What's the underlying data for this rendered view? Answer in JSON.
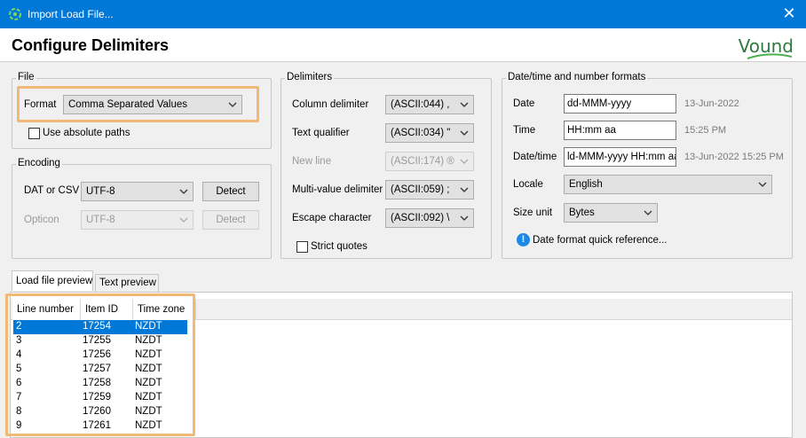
{
  "window": {
    "title": "Import Load File...",
    "close_icon": "close-icon",
    "app_icon": "import-icon"
  },
  "header": {
    "heading": "Configure Delimiters",
    "logo_text": "Vound",
    "logo_color": "#2d7a3f"
  },
  "file_group": {
    "legend": "File",
    "format_label": "Format",
    "format_value": "Comma Separated Values",
    "absolute_paths_label": "Use absolute paths",
    "absolute_paths_checked": false
  },
  "encoding_group": {
    "legend": "Encoding",
    "dat_label": "DAT or CSV",
    "dat_value": "UTF-8",
    "dat_detect": "Detect",
    "opticon_label": "Opticon",
    "opticon_value": "UTF-8",
    "opticon_detect": "Detect"
  },
  "delimiters_group": {
    "legend": "Delimiters",
    "column_label": "Column delimiter",
    "column_value": "(ASCII:044) ,",
    "text_qualifier_label": "Text qualifier",
    "text_qualifier_value": "(ASCII:034) \"",
    "new_line_label": "New line",
    "new_line_value": "(ASCII:174) ®",
    "multi_value_label": "Multi-value delimiter",
    "multi_value_value": "(ASCII:059) ;",
    "escape_label": "Escape character",
    "escape_value": "(ASCII:092) \\",
    "strict_quotes_label": "Strict quotes",
    "strict_quotes_checked": false
  },
  "formats_group": {
    "legend": "Date/time and number formats",
    "date_label": "Date",
    "date_value": "dd-MMM-yyyy",
    "date_example": "13-Jun-2022",
    "time_label": "Time",
    "time_value": "HH:mm aa",
    "time_example": "15:25 PM",
    "datetime_label": "Date/time",
    "datetime_value": "ld-MMM-yyyy HH:mm aa",
    "datetime_example": "13-Jun-2022 15:25 PM",
    "locale_label": "Locale",
    "locale_value": "English",
    "size_unit_label": "Size unit",
    "size_unit_value": "Bytes",
    "quick_reference_link": "Date format quick reference...",
    "info_icon": "info-icon"
  },
  "tabs": [
    {
      "label": "Load file preview",
      "active": true
    },
    {
      "label": "Text preview",
      "active": false
    }
  ],
  "preview_table": {
    "columns": [
      "Line number",
      "Item ID",
      "Time zone"
    ],
    "rows": [
      {
        "line": "2",
        "item_id": "17254",
        "tz": "NZDT",
        "selected": true
      },
      {
        "line": "3",
        "item_id": "17255",
        "tz": "NZDT"
      },
      {
        "line": "4",
        "item_id": "17256",
        "tz": "NZDT"
      },
      {
        "line": "5",
        "item_id": "17257",
        "tz": "NZDT"
      },
      {
        "line": "6",
        "item_id": "17258",
        "tz": "NZDT"
      },
      {
        "line": "7",
        "item_id": "17259",
        "tz": "NZDT"
      },
      {
        "line": "8",
        "item_id": "17260",
        "tz": "NZDT"
      },
      {
        "line": "9",
        "item_id": "17261",
        "tz": "NZDT"
      }
    ]
  },
  "colors": {
    "title_bar": "#0078d7",
    "highlight": "#f2b875",
    "selection": "#0078d7"
  }
}
